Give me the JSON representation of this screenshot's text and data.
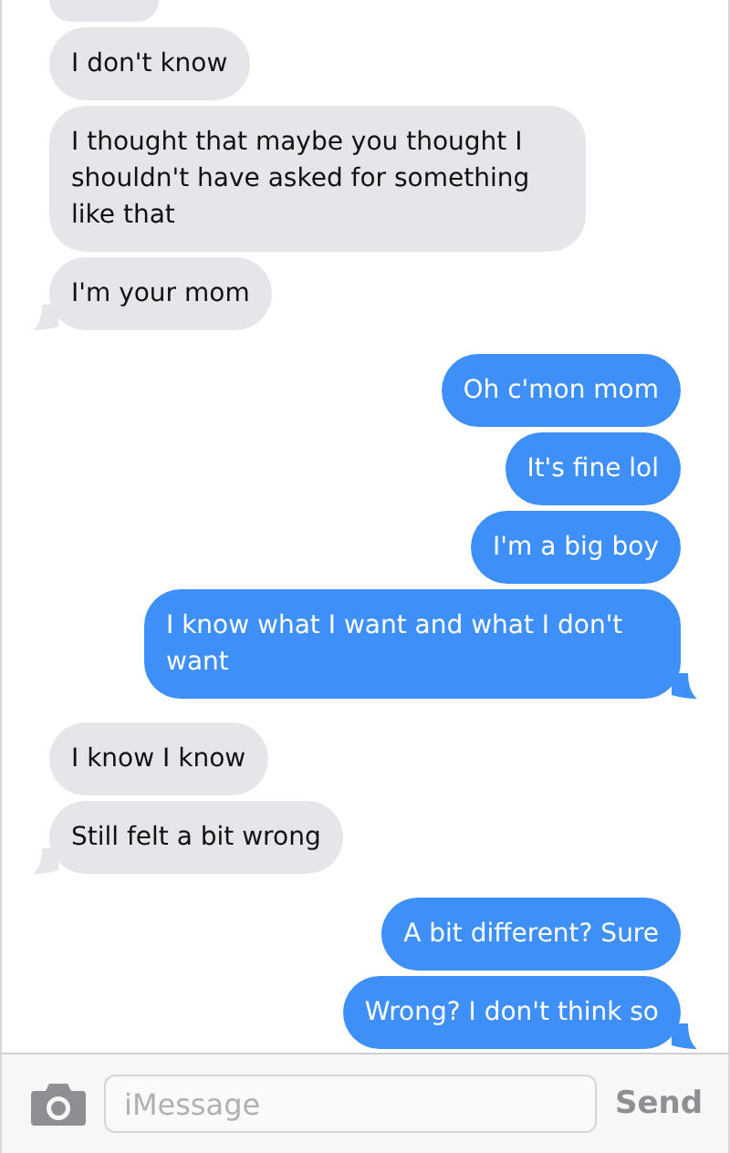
{
  "messages": [
    {
      "kind": "incoming",
      "text": "I don't know"
    },
    {
      "kind": "incoming",
      "text": "I thought that maybe you thought I shouldn't have asked for something like that"
    },
    {
      "kind": "incoming",
      "text": "I'm your mom"
    },
    {
      "kind": "outgoing",
      "text": "Oh c'mon mom"
    },
    {
      "kind": "outgoing",
      "text": "It's fine lol"
    },
    {
      "kind": "outgoing",
      "text": "I'm a big boy"
    },
    {
      "kind": "outgoing",
      "text": "I know what I want and what I don't want"
    },
    {
      "kind": "incoming",
      "text": "I know I know"
    },
    {
      "kind": "incoming",
      "text": "Still felt a bit wrong"
    },
    {
      "kind": "outgoing",
      "text": "A bit different? Sure"
    },
    {
      "kind": "outgoing",
      "text": "Wrong? I don't think so"
    }
  ],
  "composer": {
    "placeholder": "iMessage",
    "send": "Send",
    "send_disabled": true
  }
}
